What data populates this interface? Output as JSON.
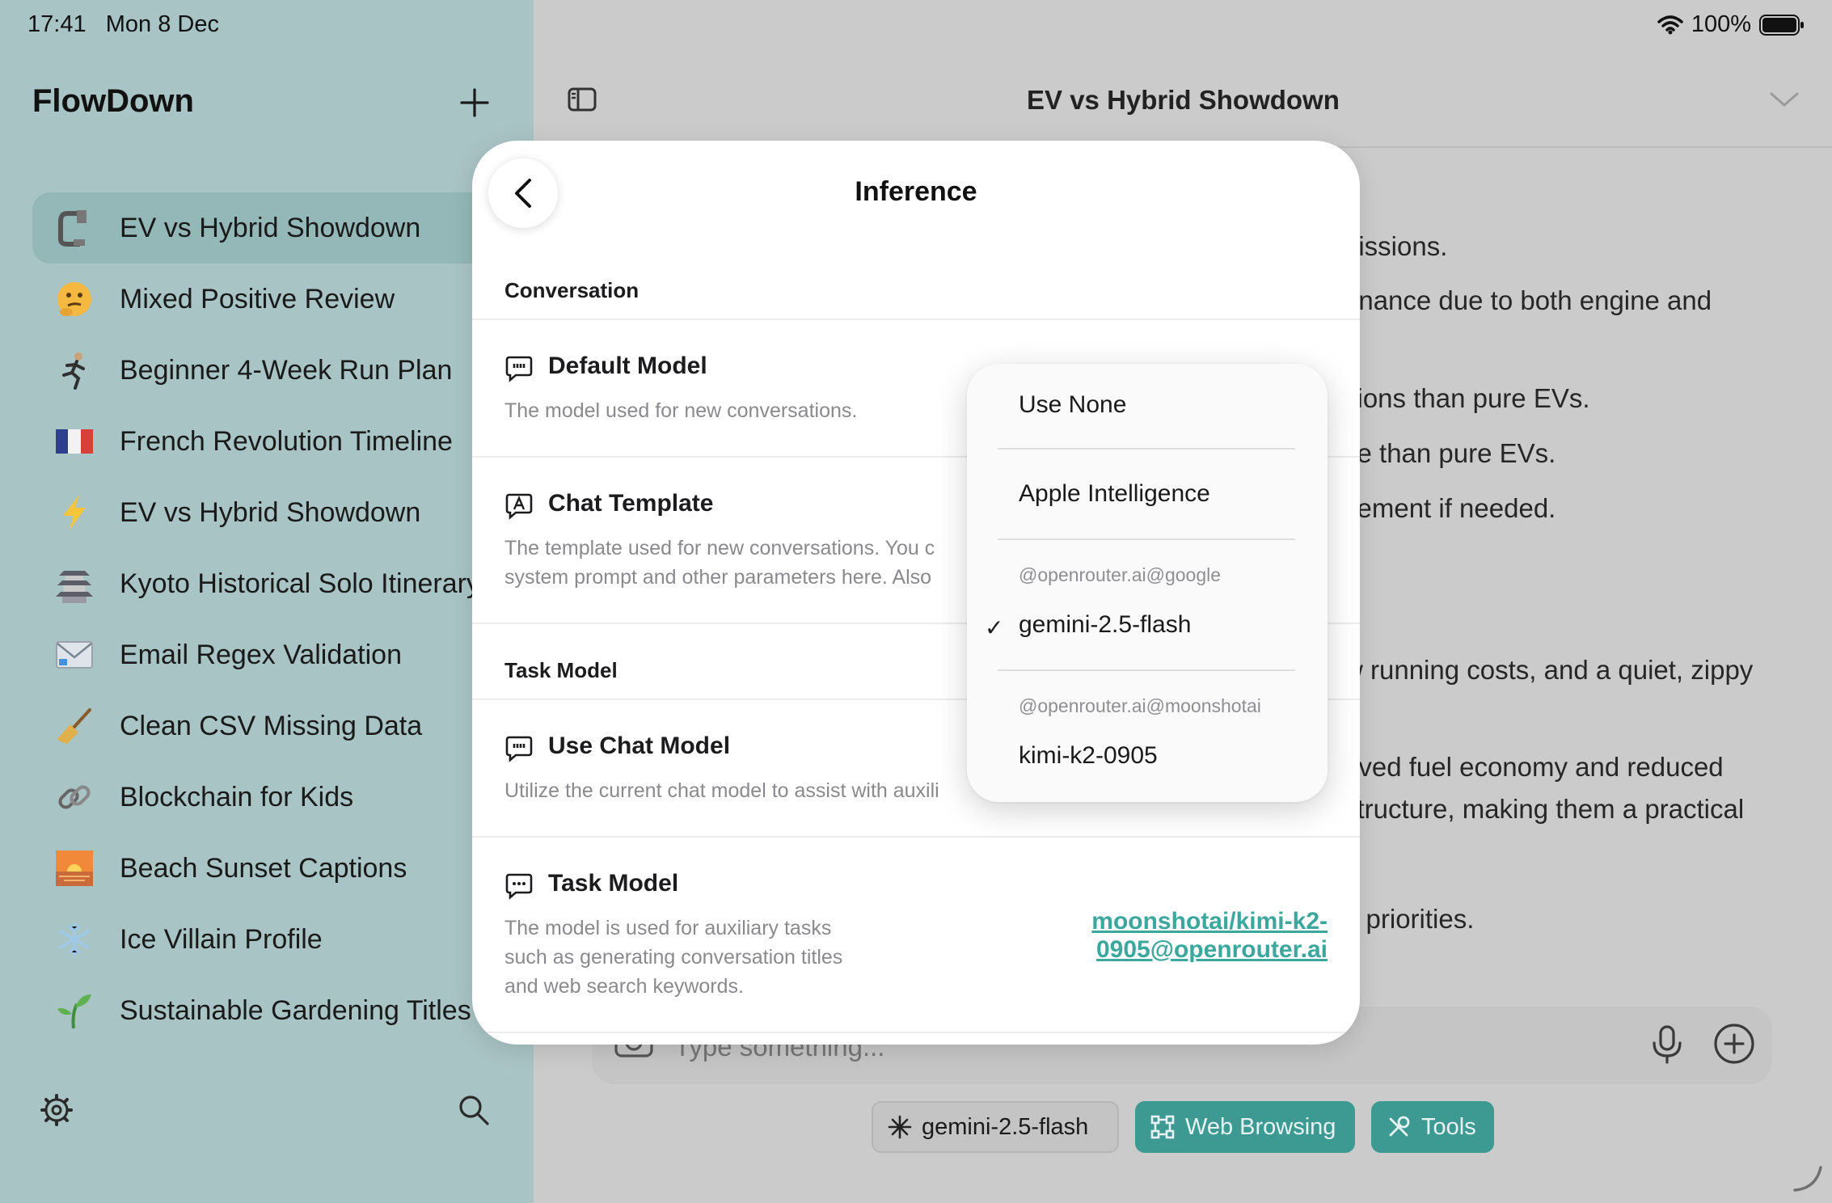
{
  "status_bar": {
    "time": "17:41",
    "date": "Mon 8 Dec",
    "battery": "100%"
  },
  "sidebar": {
    "app_title": "FlowDown",
    "conversations": [
      {
        "icon": "clamp-icon",
        "label": "EV vs Hybrid Showdown",
        "active": true
      },
      {
        "icon": "thinking-face-icon",
        "label": "Mixed Positive Review"
      },
      {
        "icon": "runner-icon",
        "label": "Beginner 4-Week Run Plan"
      },
      {
        "icon": "france-flag-icon",
        "label": "French Revolution Timeline"
      },
      {
        "icon": "lightning-icon",
        "label": "EV vs Hybrid Showdown"
      },
      {
        "icon": "pagoda-icon",
        "label": "Kyoto Historical Solo Itinerary"
      },
      {
        "icon": "envelope-icon",
        "label": "Email Regex Validation"
      },
      {
        "icon": "broom-icon",
        "label": "Clean CSV Missing Data"
      },
      {
        "icon": "link-icon",
        "label": "Blockchain for Kids"
      },
      {
        "icon": "sunset-icon",
        "label": "Beach Sunset Captions"
      },
      {
        "icon": "snowflake-icon",
        "label": "Ice Villain Profile"
      },
      {
        "icon": "seedling-icon",
        "label": "Sustainable Gardening Titles"
      }
    ]
  },
  "main": {
    "chat_title": "EV vs Hybrid Showdown",
    "background_lines": [
      "nissions.",
      "enance due to both engine and",
      "sions than pure EVs.",
      "ve than pure EVs.",
      "cement if needed.",
      "w running costs, and a quiet, zippy",
      "oved fuel economy and reduced",
      "structure, making them a practical",
      "d priorities."
    ],
    "composer_placeholder": "Type something...",
    "chips": {
      "model": "gemini-2.5-flash",
      "web": "Web Browsing",
      "tools": "Tools"
    }
  },
  "modal": {
    "title": "Inference",
    "section_conversation": "Conversation",
    "default_model": {
      "title": "Default Model",
      "desc": "The model used for new conversations."
    },
    "chat_template": {
      "title": "Chat Template",
      "desc_line1": "The template used for new conversations. You c",
      "desc_line2": "system prompt and other parameters here. Also"
    },
    "section_task": "Task Model",
    "use_chat_model": {
      "title": "Use Chat Model",
      "desc": "Utilize the current chat model to assist with auxili"
    },
    "task_model": {
      "title": "Task Model",
      "desc_line1": "The model is used for auxiliary tasks",
      "desc_line2": "such as generating conversation titles",
      "desc_line3": "and web search keywords.",
      "value": "moonshotai/kimi-k2-0905@openrouter.ai"
    }
  },
  "popover": {
    "use_none": "Use None",
    "apple": "Apple Intelligence",
    "group_google": "@openrouter.ai@google",
    "gemini": "gemini-2.5-flash",
    "checkmark": "✓",
    "group_moonshot": "@openrouter.ai@moonshotai",
    "kimi": "kimi-k2-0905"
  },
  "colors": {
    "accent": "#3ba79d",
    "sidebar": "#a9c4c5",
    "chip_teal": "#3d9a93"
  }
}
